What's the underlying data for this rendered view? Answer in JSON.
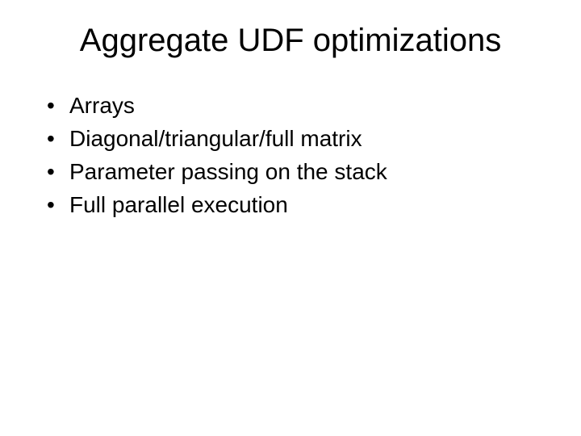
{
  "slide": {
    "title": "Aggregate UDF optimizations",
    "bullets": [
      "Arrays",
      "Diagonal/triangular/full matrix",
      "Parameter passing on the stack",
      "Full parallel execution"
    ]
  }
}
